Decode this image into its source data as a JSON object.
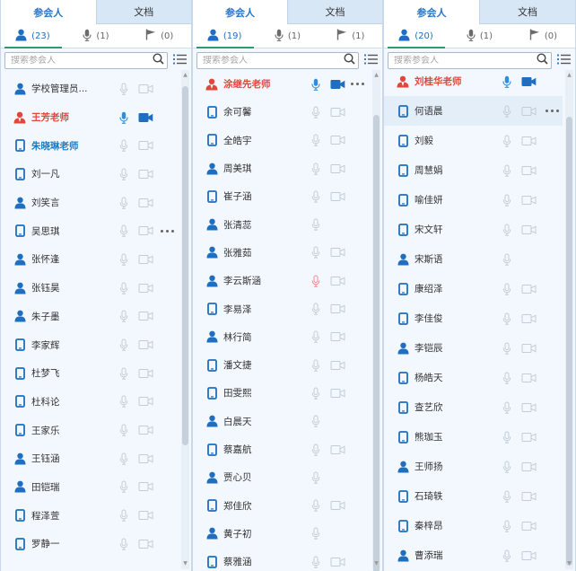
{
  "colors": {
    "accent": "#2a75c5",
    "host_red": "#e0473b",
    "icon_blue": "#1f6ec0",
    "speaking_blue": "#2b8ee0",
    "disabled_gray": "#c4ccd4",
    "warn_red": "#f08c8c",
    "tab_underline": "#2a9d6e"
  },
  "panels": [
    {
      "tabs": [
        {
          "label": "参会人",
          "active": true
        },
        {
          "label": "文档",
          "active": false
        }
      ],
      "filters": {
        "all": "(23)",
        "speaking": "(1)",
        "hands": "(0)"
      },
      "search_placeholder": "搜索参会人",
      "participants": [
        {
          "name": "学校管理员...",
          "device": "person",
          "role": "normal",
          "mic": "off",
          "cam": "off"
        },
        {
          "name": "王芳老师",
          "device": "person",
          "role": "host",
          "mic": "on",
          "cam": "on"
        },
        {
          "name": "朱晓琳老师",
          "device": "mobile",
          "role": "blue",
          "mic": "off",
          "cam": "off"
        },
        {
          "name": "刘一凡",
          "device": "mobile",
          "role": "normal",
          "mic": "off",
          "cam": "off"
        },
        {
          "name": "刘笑言",
          "device": "person",
          "role": "normal",
          "mic": "off",
          "cam": "off"
        },
        {
          "name": "吴思琪",
          "device": "mobile",
          "role": "normal",
          "mic": "off",
          "cam": "off",
          "more": true
        },
        {
          "name": "张怀逢",
          "device": "person",
          "role": "normal",
          "mic": "off",
          "cam": "off"
        },
        {
          "name": "张钰昊",
          "device": "person",
          "role": "normal",
          "mic": "off",
          "cam": "off"
        },
        {
          "name": "朱子墨",
          "device": "person",
          "role": "normal",
          "mic": "off",
          "cam": "off"
        },
        {
          "name": "李家辉",
          "device": "mobile",
          "role": "normal",
          "mic": "off",
          "cam": "off"
        },
        {
          "name": "杜梦飞",
          "device": "mobile",
          "role": "normal",
          "mic": "off",
          "cam": "off"
        },
        {
          "name": "杜科论",
          "device": "mobile",
          "role": "normal",
          "mic": "off",
          "cam": "off"
        },
        {
          "name": "王家乐",
          "device": "mobile",
          "role": "normal",
          "mic": "off",
          "cam": "off"
        },
        {
          "name": "王钰涵",
          "device": "person",
          "role": "normal",
          "mic": "off",
          "cam": "off"
        },
        {
          "name": "田铠瑞",
          "device": "person",
          "role": "normal",
          "mic": "off",
          "cam": "off"
        },
        {
          "name": "程泽萱",
          "device": "mobile",
          "role": "normal",
          "mic": "off",
          "cam": "off"
        },
        {
          "name": "罗静一",
          "device": "mobile",
          "role": "normal",
          "mic": "off",
          "cam": "off"
        }
      ]
    },
    {
      "tabs": [
        {
          "label": "参会人",
          "active": true
        },
        {
          "label": "文档",
          "active": false
        }
      ],
      "filters": {
        "all": "(19)",
        "speaking": "(1)",
        "hands": "(1)"
      },
      "search_placeholder": "搜索参会人",
      "participants": [
        {
          "name": "涂继先老师",
          "device": "person",
          "role": "host",
          "mic": "on",
          "cam": "on",
          "more": true
        },
        {
          "name": "余可馨",
          "device": "mobile",
          "role": "normal",
          "mic": "off",
          "cam": "off"
        },
        {
          "name": "全皓宇",
          "device": "mobile",
          "role": "normal",
          "mic": "off",
          "cam": "off"
        },
        {
          "name": "周美琪",
          "device": "person",
          "role": "normal",
          "mic": "off",
          "cam": "off"
        },
        {
          "name": "崔子涵",
          "device": "mobile",
          "role": "normal",
          "mic": "off",
          "cam": "off"
        },
        {
          "name": "张清蕊",
          "device": "person",
          "role": "normal",
          "mic": "off",
          "cam": "none"
        },
        {
          "name": "张雅茹",
          "device": "person",
          "role": "normal",
          "mic": "off",
          "cam": "off"
        },
        {
          "name": "李云斯涵",
          "device": "person",
          "role": "normal",
          "mic": "warn",
          "cam": "off"
        },
        {
          "name": "李易泽",
          "device": "mobile",
          "role": "normal",
          "mic": "off",
          "cam": "off"
        },
        {
          "name": "林行简",
          "device": "person",
          "role": "normal",
          "mic": "off",
          "cam": "off"
        },
        {
          "name": "潘文捷",
          "device": "mobile",
          "role": "normal",
          "mic": "off",
          "cam": "off"
        },
        {
          "name": "田雯熙",
          "device": "mobile",
          "role": "normal",
          "mic": "off",
          "cam": "off"
        },
        {
          "name": "白晨天",
          "device": "person",
          "role": "normal",
          "mic": "off",
          "cam": "none"
        },
        {
          "name": "蔡嘉航",
          "device": "mobile",
          "role": "normal",
          "mic": "off",
          "cam": "off"
        },
        {
          "name": "贾心贝",
          "device": "person",
          "role": "normal",
          "mic": "off",
          "cam": "none"
        },
        {
          "name": "郑佳欣",
          "device": "mobile",
          "role": "normal",
          "mic": "off",
          "cam": "off"
        },
        {
          "name": "黄子初",
          "device": "person",
          "role": "normal",
          "mic": "off",
          "cam": "none"
        },
        {
          "name": "蔡雅涵",
          "device": "mobile",
          "role": "normal",
          "mic": "off",
          "cam": "off"
        }
      ]
    },
    {
      "tabs": [
        {
          "label": "参会人",
          "active": true
        },
        {
          "label": "文档",
          "active": false
        }
      ],
      "filters": {
        "all": "(20)",
        "speaking": "(1)",
        "hands": "(0)"
      },
      "search_placeholder": "搜索参会人",
      "participants": [
        {
          "name": "刘桂华老师",
          "device": "person",
          "role": "host",
          "mic": "on",
          "cam": "on"
        },
        {
          "name": "何语晨",
          "device": "mobile",
          "role": "normal",
          "mic": "off",
          "cam": "off",
          "more": true,
          "highlight": true
        },
        {
          "name": "刘毅",
          "device": "mobile",
          "role": "normal",
          "mic": "off",
          "cam": "off"
        },
        {
          "name": "周慧娟",
          "device": "mobile",
          "role": "normal",
          "mic": "off",
          "cam": "off"
        },
        {
          "name": "喻佳妍",
          "device": "mobile",
          "role": "normal",
          "mic": "off",
          "cam": "off"
        },
        {
          "name": "宋文轩",
          "device": "mobile",
          "role": "normal",
          "mic": "off",
          "cam": "off"
        },
        {
          "name": "宋斯语",
          "device": "person",
          "role": "normal",
          "mic": "off",
          "cam": "none"
        },
        {
          "name": "康绍泽",
          "device": "mobile",
          "role": "normal",
          "mic": "off",
          "cam": "off"
        },
        {
          "name": "李佳俊",
          "device": "mobile",
          "role": "normal",
          "mic": "off",
          "cam": "off"
        },
        {
          "name": "李铠辰",
          "device": "person",
          "role": "normal",
          "mic": "off",
          "cam": "off"
        },
        {
          "name": "杨皓天",
          "device": "mobile",
          "role": "normal",
          "mic": "off",
          "cam": "off"
        },
        {
          "name": "查艺欣",
          "device": "mobile",
          "role": "normal",
          "mic": "off",
          "cam": "off"
        },
        {
          "name": "熊珈玉",
          "device": "mobile",
          "role": "normal",
          "mic": "off",
          "cam": "off"
        },
        {
          "name": "王师扬",
          "device": "person",
          "role": "normal",
          "mic": "off",
          "cam": "off"
        },
        {
          "name": "石琦轶",
          "device": "mobile",
          "role": "normal",
          "mic": "off",
          "cam": "off"
        },
        {
          "name": "秦梓昂",
          "device": "mobile",
          "role": "normal",
          "mic": "off",
          "cam": "off"
        },
        {
          "name": "曹添瑞",
          "device": "person",
          "role": "normal",
          "mic": "off",
          "cam": "off"
        }
      ]
    }
  ]
}
